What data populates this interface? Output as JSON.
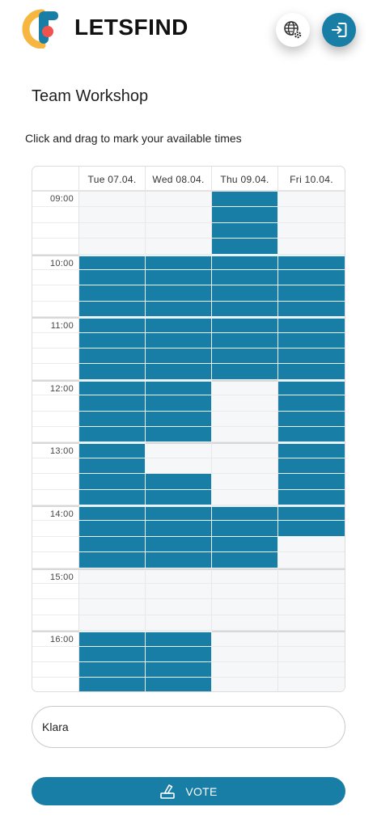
{
  "app": {
    "brand": "LETSFIND"
  },
  "header": {
    "lang_icon": "globe-settings-icon",
    "login_icon": "login-icon"
  },
  "event": {
    "title": "Team Workshop",
    "hint": "Click and drag to mark your available times"
  },
  "grid": {
    "days": [
      "Tue 07.04.",
      "Wed 08.04.",
      "Thu 09.04.",
      "Fri 10.04."
    ],
    "hours": [
      "09:00",
      "10:00",
      "11:00",
      "12:00",
      "13:00",
      "14:00",
      "15:00",
      "16:00"
    ],
    "slots_per_hour": 4,
    "available": [
      [
        0,
        0,
        0,
        0,
        1,
        1,
        1,
        1,
        1,
        1,
        1,
        1,
        1,
        1,
        1,
        1,
        1,
        1,
        1,
        1,
        1,
        1,
        1,
        1,
        0,
        0,
        0,
        0,
        1,
        1,
        1,
        1
      ],
      [
        0,
        0,
        0,
        0,
        1,
        1,
        1,
        1,
        1,
        1,
        1,
        1,
        1,
        1,
        1,
        1,
        0,
        0,
        1,
        1,
        1,
        1,
        1,
        1,
        0,
        0,
        0,
        0,
        1,
        1,
        1,
        1
      ],
      [
        1,
        1,
        1,
        1,
        1,
        1,
        1,
        1,
        1,
        1,
        1,
        1,
        0,
        0,
        0,
        0,
        0,
        0,
        0,
        0,
        1,
        1,
        1,
        1,
        0,
        0,
        0,
        0,
        0,
        0,
        0,
        0
      ],
      [
        0,
        0,
        0,
        0,
        1,
        1,
        1,
        1,
        1,
        1,
        1,
        1,
        1,
        1,
        1,
        1,
        1,
        1,
        1,
        1,
        1,
        1,
        0,
        0,
        0,
        0,
        0,
        0,
        0,
        0,
        0,
        0
      ]
    ],
    "available_color": "#187ea6",
    "empty_color": "#f5f7f8"
  },
  "form": {
    "name_value": "Klara",
    "vote_label": "VOTE",
    "vote_icon": "ballot-box-icon"
  },
  "colors": {
    "accent": "#187ea6"
  }
}
